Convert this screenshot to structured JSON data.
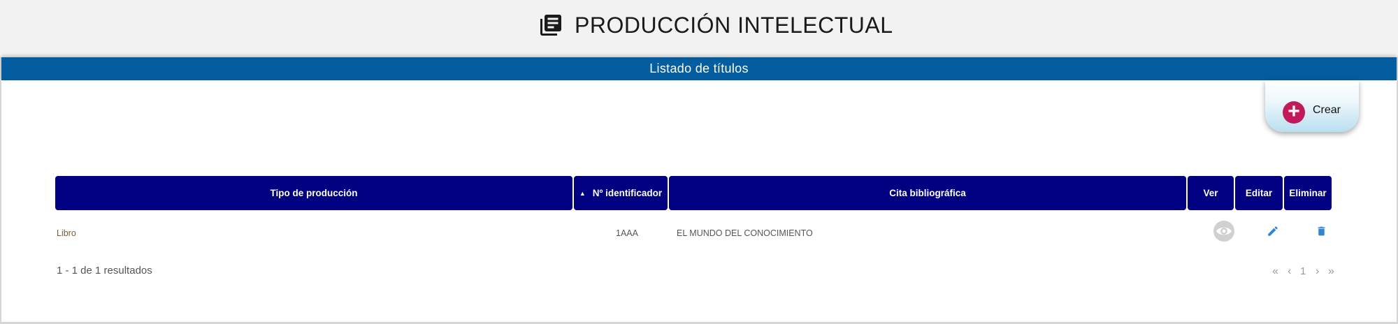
{
  "header": {
    "title": "PRODUCCIÓN INTELECTUAL",
    "icon": "library-books-icon"
  },
  "panel": {
    "title": "Listado de títulos"
  },
  "actions": {
    "create_label": "Crear",
    "create_icon": "plus-circle-icon"
  },
  "table": {
    "columns": [
      "Tipo de producción",
      "Nº identificador",
      "Cita bibliográfica",
      "Ver",
      "Editar",
      "Eliminar"
    ],
    "sort_indicator": "▲",
    "rows": [
      {
        "tipo": "Libro",
        "identificador": "1AAA",
        "cita": "EL MUNDO DEL CONOCIMIENTO",
        "icons": [
          "eye-icon",
          "pencil-icon",
          "trash-icon"
        ]
      }
    ]
  },
  "footer": {
    "results_text": "1 - 1 de 1 resultados",
    "pagination": {
      "first": "«",
      "prev": "‹",
      "page": "1",
      "next": "›",
      "last": "»"
    }
  },
  "colors": {
    "header_bar": "#045d9e",
    "table_header": "#000080",
    "create_button": "#c2195b",
    "action_icon": "#2f86d1",
    "view_icon": "#cccccc"
  }
}
